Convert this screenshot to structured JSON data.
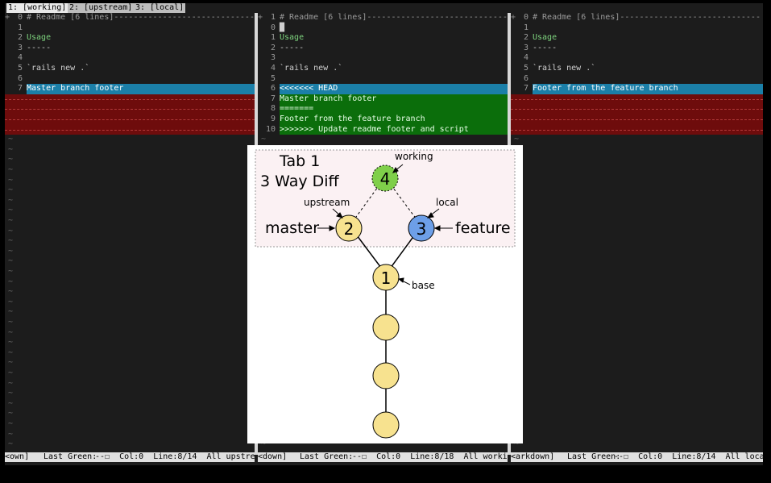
{
  "tabs": [
    {
      "label": "1: [working]",
      "selected": true
    },
    {
      "label": "2: [upstream]",
      "selected": false
    },
    {
      "label": "3: [local]",
      "selected": false
    }
  ],
  "panes": {
    "left": {
      "lines": [
        {
          "n": "0",
          "t": "# Readme [6 lines]-----------------------------",
          "cls": "fold"
        },
        {
          "n": "1",
          "t": ""
        },
        {
          "n": "2",
          "t": "Usage",
          "cls": "usage"
        },
        {
          "n": "3",
          "t": "-----"
        },
        {
          "n": "4",
          "t": ""
        },
        {
          "n": "5",
          "t": "`rails new .`"
        },
        {
          "n": "6",
          "t": ""
        },
        {
          "n": "7",
          "t": "Master branch footer",
          "cls": "hl"
        }
      ],
      "status": {
        "mode": "<own]",
        "last_green": "Last Green:",
        "col": "--☐  Col:0  Line:8/14  All upstream"
      }
    },
    "middle": {
      "lines": [
        {
          "n": "1",
          "t": "# Readme [6 lines]-----------------------------",
          "cls": "fold"
        },
        {
          "n": "0",
          "t": "█"
        },
        {
          "n": "1",
          "t": "Usage",
          "cls": "usage"
        },
        {
          "n": "2",
          "t": "-----"
        },
        {
          "n": "3",
          "t": ""
        },
        {
          "n": "4",
          "t": "`rails new .`"
        },
        {
          "n": "5",
          "t": ""
        },
        {
          "n": "6",
          "t": "<<<<<<< HEAD",
          "cls": "head"
        },
        {
          "n": "7",
          "t": "Master branch footer",
          "cls": "grn"
        },
        {
          "n": "8",
          "t": "=======",
          "cls": "grn"
        },
        {
          "n": "9",
          "t": "Footer from the feature branch",
          "cls": "grn"
        },
        {
          "n": "10",
          "t": ">>>>>>> Update readme footer and script",
          "cls": "grn"
        }
      ],
      "status": {
        "mode": "<down]",
        "last_green": "Last Green:",
        "col": "--☐  Col:0  Line:8/18  All working"
      }
    },
    "right": {
      "lines": [
        {
          "n": "0",
          "t": "# Readme [6 lines]-----------------------------",
          "cls": "fold"
        },
        {
          "n": "1",
          "t": ""
        },
        {
          "n": "2",
          "t": "Usage",
          "cls": "usage"
        },
        {
          "n": "3",
          "t": "-----"
        },
        {
          "n": "4",
          "t": ""
        },
        {
          "n": "5",
          "t": "`rails new .`"
        },
        {
          "n": "6",
          "t": ""
        },
        {
          "n": "7",
          "t": "Footer from the feature branch",
          "cls": "hl"
        }
      ],
      "status": {
        "mode": "<arkdown]",
        "last_green": "Last Green:",
        "col": "--☐  Col:0  Line:8/14  All local"
      }
    }
  },
  "diagram": {
    "title_line1": "Tab 1",
    "title_line2": "3 Way Diff",
    "labels": {
      "working": "working",
      "upstream": "upstream",
      "local": "local",
      "base": "base",
      "master": "master",
      "feature": "feature"
    },
    "nodes": {
      "n4": "4",
      "n2": "2",
      "n3": "3",
      "n1": "1"
    },
    "colors": {
      "yellow": "#f7e28f",
      "green": "#7fcf4a",
      "blue": "#6d9fe8",
      "box": "#fbf1f3"
    }
  },
  "colors": {
    "terminal_bg": "#1c1c1c",
    "highlight": "#1b7fa8",
    "conflict_green": "#0b6e0b",
    "deleted": "#6e0c0c"
  }
}
